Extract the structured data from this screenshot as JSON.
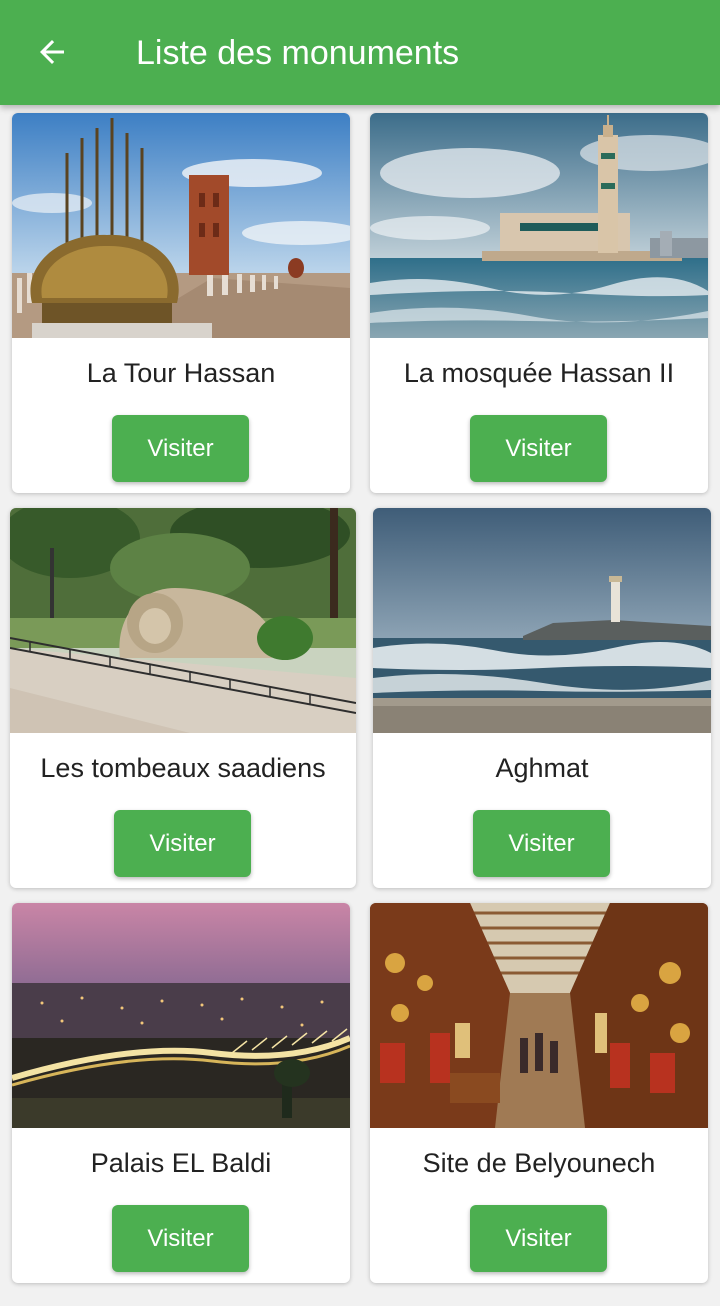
{
  "appbar": {
    "title": "Liste des monuments",
    "back_icon": "arrow-back-icon",
    "color": "#4caf50"
  },
  "monuments": [
    {
      "name": "La Tour Hassan",
      "button": "Visiter",
      "image": "tour-hassan-photo"
    },
    {
      "name": "La mosquée Hassan II",
      "button": "Visiter",
      "image": "mosque-hassan-ii-photo"
    },
    {
      "name": "Les tombeaux saadiens",
      "button": "Visiter",
      "image": "lion-statue-park-photo"
    },
    {
      "name": "Aghmat",
      "button": "Visiter",
      "image": "lighthouse-sea-photo"
    },
    {
      "name": "Palais EL Baldi",
      "button": "Visiter",
      "image": "city-bridge-night-photo"
    },
    {
      "name": "Site de Belyounech",
      "button": "Visiter",
      "image": "souk-market-photo"
    }
  ]
}
